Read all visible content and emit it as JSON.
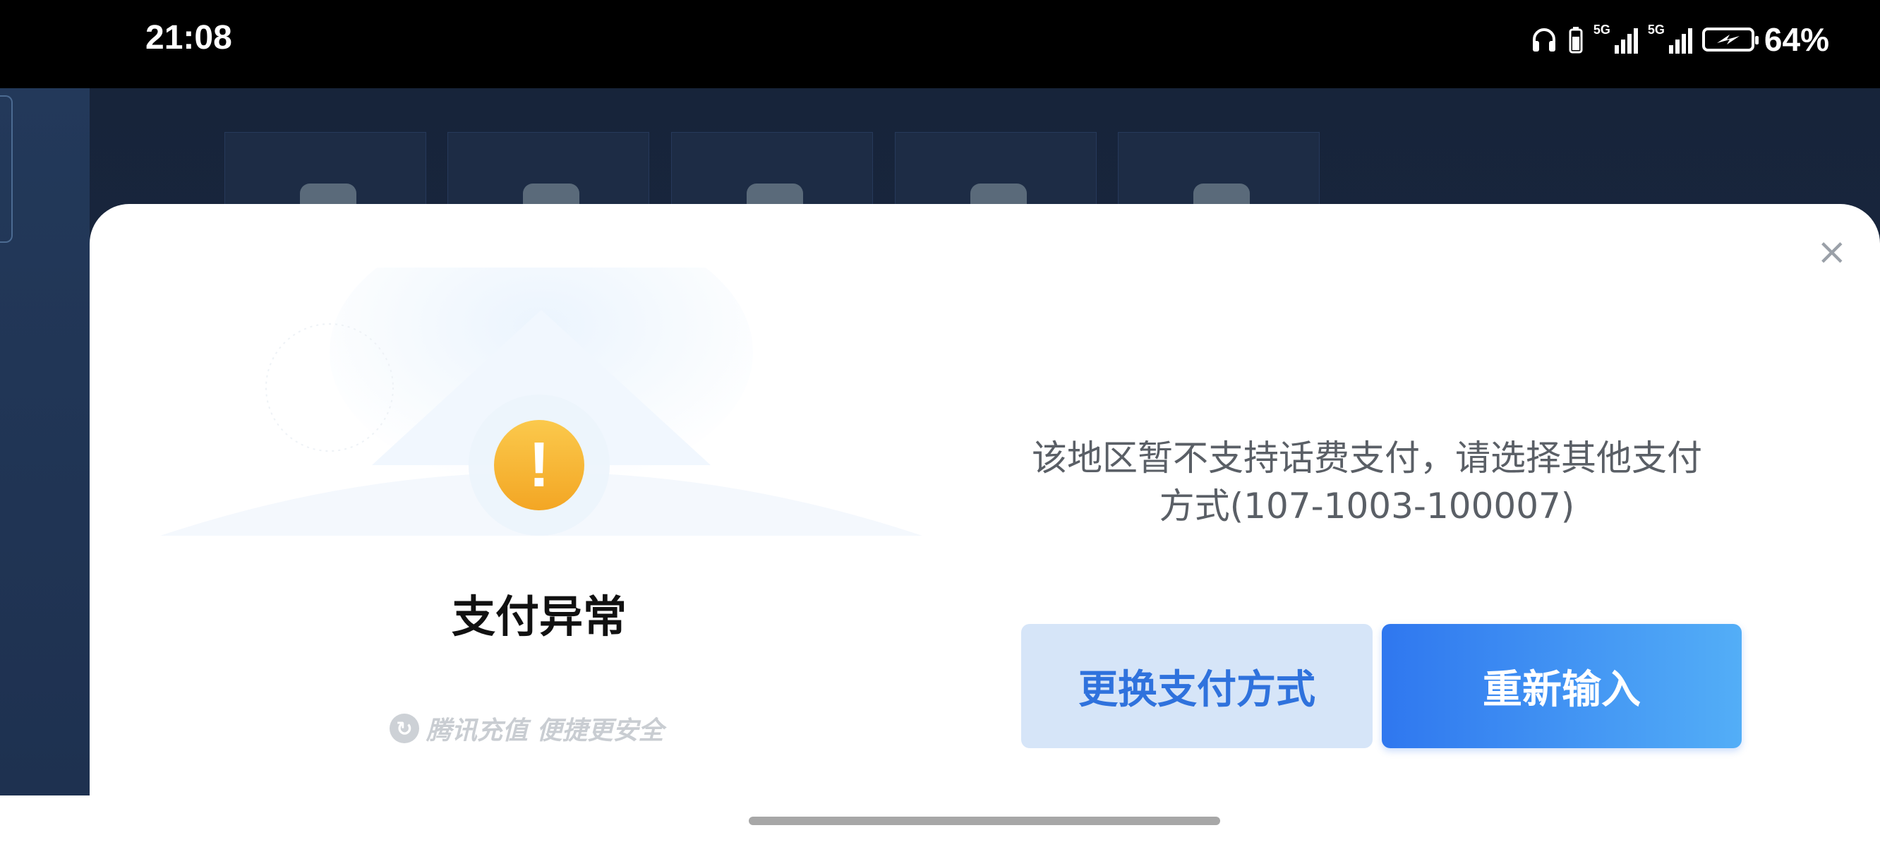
{
  "status_bar": {
    "time": "21:08",
    "network_1": "5G",
    "network_2": "5G",
    "battery_percent": "64%",
    "icons": [
      "headphones-icon",
      "battery-small-icon",
      "signal-icon",
      "signal-icon",
      "battery-charging-icon"
    ]
  },
  "dialog": {
    "title": "支付异常",
    "message_line1": "该地区暂不支持话费支付，请选择其他支付",
    "message_line2": "方式(107-1003-100007)",
    "brand_slogan": "腾讯充值 便捷更安全",
    "close_icon": "close-icon",
    "warning_icon_glyph": "!",
    "buttons": {
      "secondary_label": "更换支付方式",
      "primary_label": "重新输入"
    },
    "colors": {
      "primary_button": "#2f77ef",
      "secondary_button": "#d6e5f8",
      "warning": "#f5b32d"
    }
  }
}
